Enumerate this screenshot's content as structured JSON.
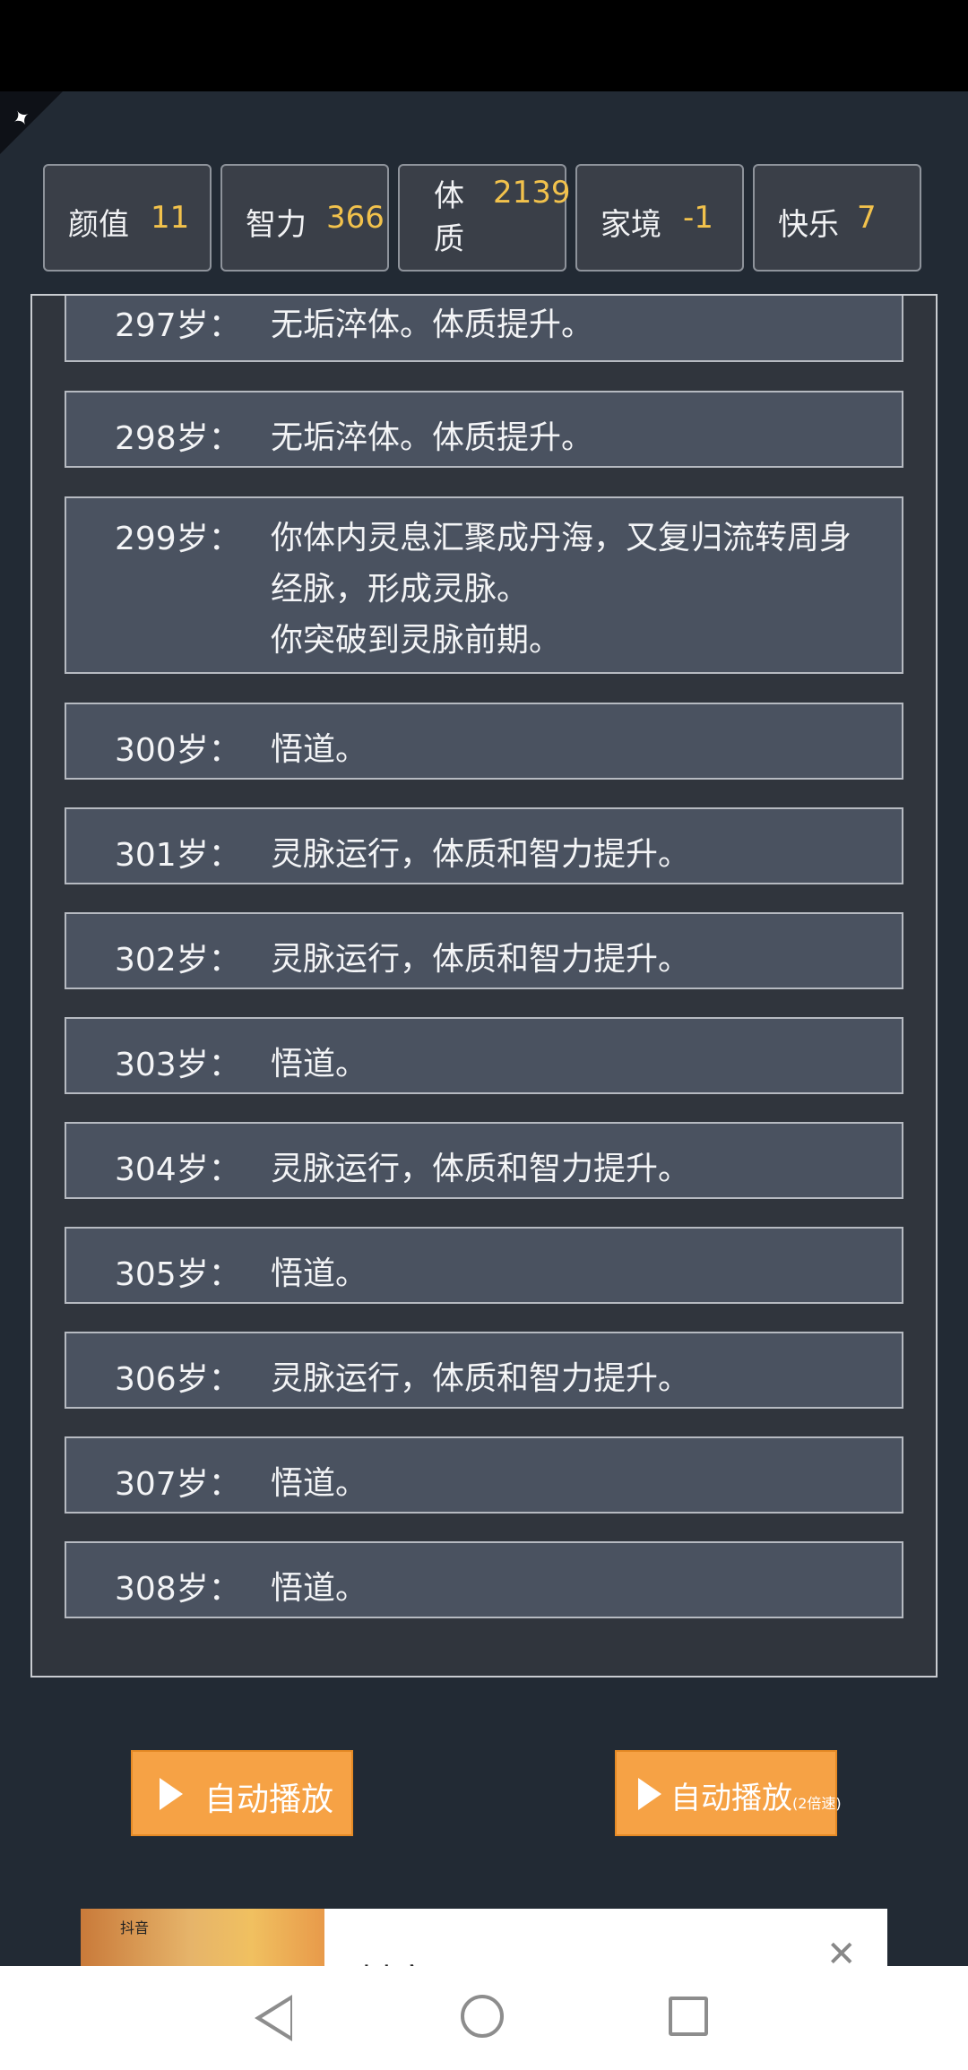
{
  "stats": [
    {
      "label": "颜值",
      "value": "11"
    },
    {
      "label": "智力",
      "value": "366"
    },
    {
      "label": "体质",
      "value": "2139"
    },
    {
      "label": "家境",
      "value": "-1"
    },
    {
      "label": "快乐",
      "value": "7"
    }
  ],
  "log": [
    {
      "age": "297岁：",
      "event": "无垢淬体。体质提升。"
    },
    {
      "age": "298岁：",
      "event": "无垢淬体。体质提升。"
    },
    {
      "age": "299岁：",
      "event": "你体内灵息汇聚成丹海，又复归流转周身经脉，形成灵脉。\n你突破到灵脉前期。"
    },
    {
      "age": "300岁：",
      "event": "悟道。"
    },
    {
      "age": "301岁：",
      "event": "灵脉运行，体质和智力提升。"
    },
    {
      "age": "302岁：",
      "event": "灵脉运行，体质和智力提升。"
    },
    {
      "age": "303岁：",
      "event": "悟道。"
    },
    {
      "age": "304岁：",
      "event": "灵脉运行，体质和智力提升。"
    },
    {
      "age": "305岁：",
      "event": "悟道。"
    },
    {
      "age": "306岁：",
      "event": "灵脉运行，体质和智力提升。"
    },
    {
      "age": "307岁：",
      "event": "悟道。"
    },
    {
      "age": "308岁：",
      "event": "悟道。"
    }
  ],
  "buttons": {
    "auto_play": "自动播放",
    "auto_play_2x": "自动播放",
    "auto_play_2x_suffix": "(2倍速)"
  },
  "ad": {
    "title": "抖音",
    "thumb_text": "抖音"
  },
  "colors": {
    "background": "#222a34",
    "stat_value": "#f2c24c",
    "button": "#f6a245"
  }
}
